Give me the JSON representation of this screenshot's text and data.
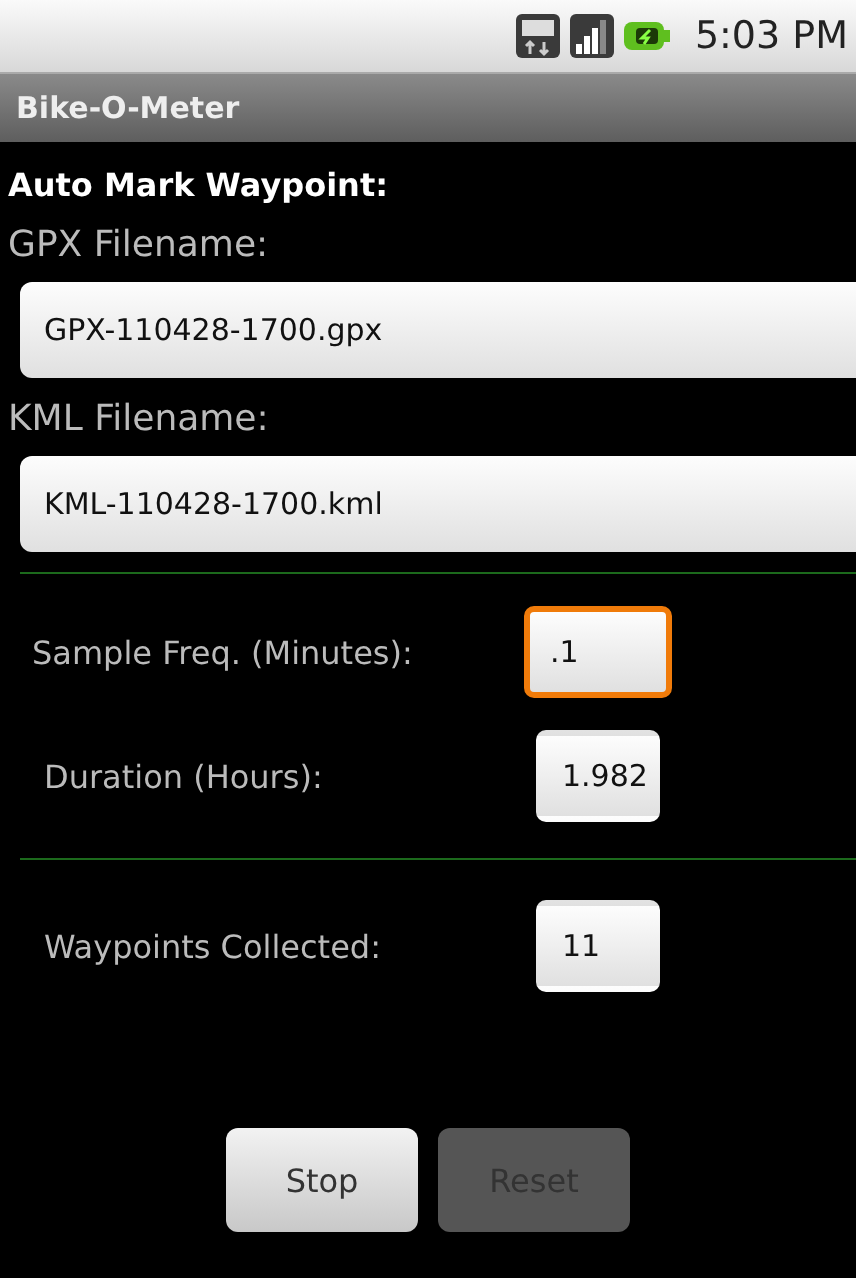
{
  "status_bar": {
    "time": "5:03 PM"
  },
  "window": {
    "title": "Bike-O-Meter"
  },
  "heading": "Auto Mark Waypoint:",
  "file_fields": [
    {
      "label": "GPX Filename:",
      "value": "GPX-110428-1700.gpx"
    },
    {
      "label": "KML Filename:",
      "value": "KML-110428-1700.kml"
    }
  ],
  "settings": [
    {
      "label": "Sample Freq. (Minutes):",
      "value": ".1",
      "focused": true
    },
    {
      "label": "Duration (Hours):",
      "value": "1.982",
      "focused": false
    }
  ],
  "stats": [
    {
      "label": "Waypoints Collected:",
      "value": "11",
      "focused": false
    }
  ],
  "buttons": [
    {
      "label": "Stop",
      "disabled": false
    },
    {
      "label": "Reset",
      "disabled": true
    }
  ]
}
